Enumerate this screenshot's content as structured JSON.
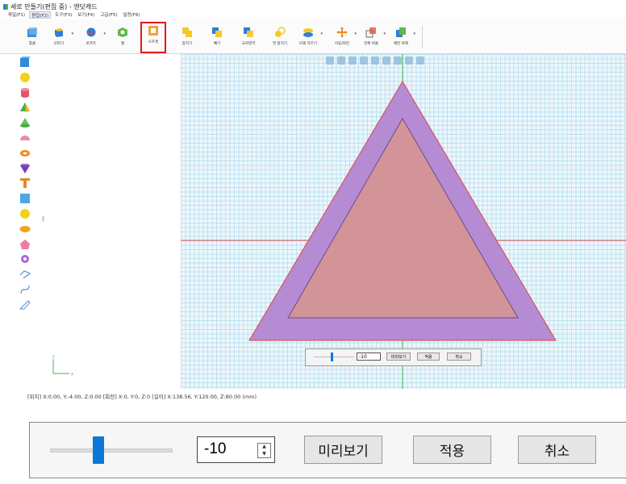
{
  "window": {
    "title": "세로 만들기(편집 중) - 엔닷캐드"
  },
  "menu": [
    {
      "label": "파일(F1)"
    },
    {
      "label": "편집(F2)",
      "active": true
    },
    {
      "label": "도구(F3)"
    },
    {
      "label": "보기(F4)"
    },
    {
      "label": "고급(F5)"
    },
    {
      "label": "설정(F6)"
    }
  ],
  "toolbar": {
    "items": [
      {
        "label": "틀출",
        "icon": "export-cube-icon"
      },
      {
        "label": "모따기",
        "icon": "chamfer-icon",
        "dropdown": true
      },
      {
        "label": "로프트",
        "icon": "loft-icon",
        "dropdown": true
      },
      {
        "label": "쉘",
        "icon": "shell-icon"
      },
      {
        "label": "오프셋",
        "icon": "offset-icon",
        "highlighted": true
      },
      {
        "label": "합치기",
        "icon": "union-icon"
      },
      {
        "label": "빼기",
        "icon": "subtract-icon"
      },
      {
        "label": "교차영역",
        "icon": "intersect-icon"
      },
      {
        "label": "면 합치기",
        "icon": "face-merge-icon"
      },
      {
        "label": "모델 자르기",
        "icon": "model-cut-icon",
        "dropdown": true
      },
      {
        "label": "이동/회전",
        "icon": "move-rotate-icon",
        "dropdown": true
      },
      {
        "label": "전체 비율",
        "icon": "scale-icon",
        "dropdown": true
      },
      {
        "label": "패턴 복제",
        "icon": "pattern-copy-icon",
        "dropdown": true
      }
    ],
    "highlight_color": "#e21a1a"
  },
  "left_tools": [
    "box-icon",
    "sphere-icon",
    "cylinder-icon",
    "pyramid-icon",
    "cone-icon",
    "hemisphere-icon",
    "torus-icon",
    "prism-icon",
    "text-icon",
    "rectangle-icon",
    "circle-icon",
    "ellipse-icon",
    "pentagon-icon",
    "gear-icon",
    "polyline-icon",
    "curve-icon",
    "sketch-icon"
  ],
  "viewport": {
    "axis_label_x": "x",
    "axis_label_y": "y",
    "colors": {
      "grid_bg": "#ecf7fc",
      "outer_triangle": "#b58bd4",
      "inner_triangle": "#d29498",
      "axis_red": "#e04646",
      "axis_green": "#3cb84a"
    }
  },
  "status": {
    "text": "[위치] X:0.00, Y:-4.00, Z:0.00  [회전] X:0, Y:0, Z:0  [길이] X:138.56, Y:120.00, Z:80.00 (mm)"
  },
  "offset_control": {
    "value": "-10",
    "slider_fraction": 0.4,
    "preview_label": "미리보기",
    "apply_label": "적용",
    "cancel_label": "취소",
    "accent": "#0a78d7"
  }
}
